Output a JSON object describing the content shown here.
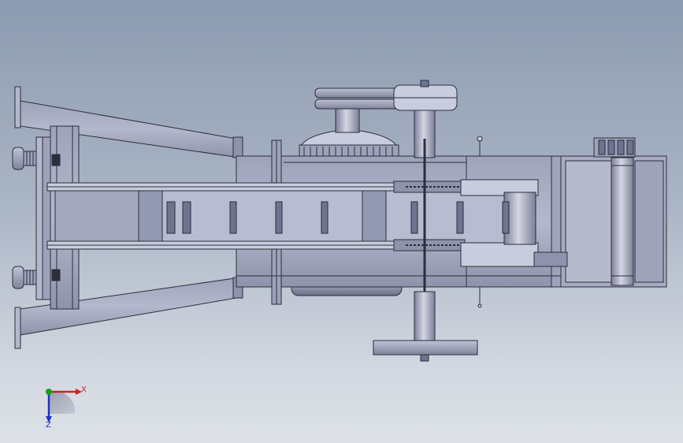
{
  "colors": {
    "background_top": "#8d9bb0",
    "background_bottom": "#dde1e7",
    "part_fill": "#a3a8bf",
    "part_light": "#c9ccdc",
    "part_dark": "#6e7390",
    "edge": "#2c2e3c",
    "axis_x": "#d22020",
    "axis_y": "#18a018",
    "axis_z": "#2030c8"
  },
  "triad": {
    "x_label": "X",
    "z_label": "Z"
  }
}
